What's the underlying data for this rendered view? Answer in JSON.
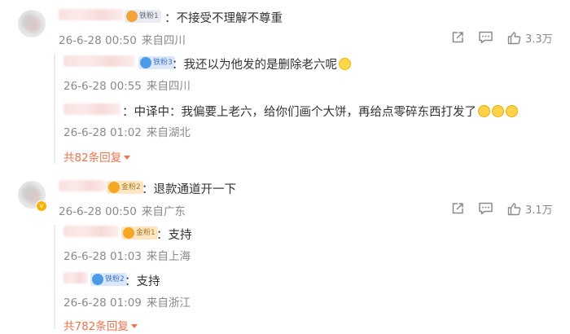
{
  "comments": [
    {
      "fan_badge": "铁粉1",
      "text": "：不接受不理解不尊重",
      "date": "26-6-28 00:50",
      "location": "来自四川",
      "like_count": "3.3万",
      "replies": [
        {
          "fan_badge": "铁粉3",
          "text": "：我还以为他发的是删除老六呢",
          "date": "26-6-28 00:55",
          "location": "来自四川"
        },
        {
          "fan_badge": "",
          "text": "：中译中：我偏要上老六，给你们画个大饼，再给点零碎东西打发了",
          "date": "26-6-28 01:02",
          "location": "来自湖北"
        }
      ],
      "more_replies": "共82条回复"
    },
    {
      "fan_badge": "金粉2",
      "text": "：退款通道开一下",
      "date": "26-6-28 00:50",
      "location": "来自广东",
      "like_count": "3.1万",
      "replies": [
        {
          "fan_badge": "金粉1",
          "text": "：支持",
          "date": "26-6-28 01:03",
          "location": "来自上海"
        },
        {
          "fan_badge": "铁粉2",
          "text": "：支持",
          "date": "26-6-28 01:09",
          "location": "来自浙江"
        }
      ],
      "more_replies": "共782条回复"
    }
  ],
  "icons": {
    "share": "share-icon",
    "comment": "comment-icon",
    "like": "thumbs-up-icon"
  },
  "colors": {
    "accent": "#eb7350",
    "meta": "#8a8a8a",
    "text": "#333333"
  }
}
